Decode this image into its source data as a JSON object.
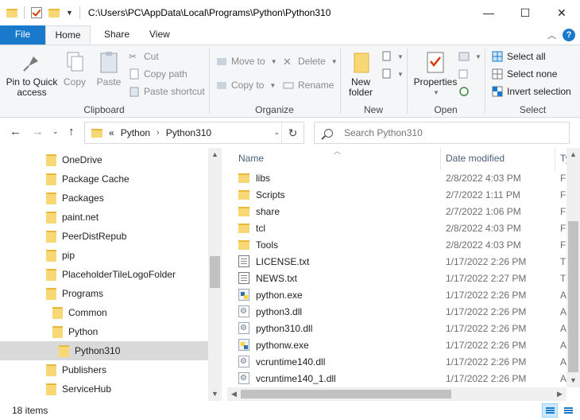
{
  "window": {
    "title_path": "C:\\Users\\PC\\AppData\\Local\\Programs\\Python\\Python310",
    "controls": {
      "minimize": "—",
      "maximize": "☐",
      "close": "✕"
    }
  },
  "ribbon_tabs": {
    "file": "File",
    "home": "Home",
    "share": "Share",
    "view": "View",
    "help": "?"
  },
  "ribbon": {
    "clipboard": {
      "label": "Clipboard",
      "pin_quick_access_line1": "Pin to Quick",
      "pin_quick_access_line2": "access",
      "copy": "Copy",
      "paste": "Paste",
      "cut": "Cut",
      "copy_path": "Copy path",
      "paste_shortcut": "Paste shortcut"
    },
    "organize": {
      "label": "Organize",
      "move_to": "Move to",
      "copy_to": "Copy to",
      "delete": "Delete",
      "rename": "Rename"
    },
    "new": {
      "label": "New",
      "new_folder_line1": "New",
      "new_folder_line2": "folder"
    },
    "open": {
      "label": "Open",
      "properties": "Properties"
    },
    "select": {
      "label": "Select",
      "select_all": "Select all",
      "select_none": "Select none",
      "invert_selection": "Invert selection"
    }
  },
  "address": {
    "overflow": "«",
    "crumbs": [
      "Python",
      "Python310"
    ],
    "search_placeholder": "Search Python310"
  },
  "nav_tree": [
    {
      "label": "OneDrive",
      "indent": 0,
      "selected": false
    },
    {
      "label": "Package Cache",
      "indent": 0,
      "selected": false
    },
    {
      "label": "Packages",
      "indent": 0,
      "selected": false
    },
    {
      "label": "paint.net",
      "indent": 0,
      "selected": false
    },
    {
      "label": "PeerDistRepub",
      "indent": 0,
      "selected": false
    },
    {
      "label": "pip",
      "indent": 0,
      "selected": false
    },
    {
      "label": "PlaceholderTileLogoFolder",
      "indent": 0,
      "selected": false
    },
    {
      "label": "Programs",
      "indent": 0,
      "selected": false
    },
    {
      "label": "Common",
      "indent": 1,
      "selected": false
    },
    {
      "label": "Python",
      "indent": 1,
      "selected": false
    },
    {
      "label": "Python310",
      "indent": 2,
      "selected": true
    },
    {
      "label": "Publishers",
      "indent": 0,
      "selected": false
    },
    {
      "label": "ServiceHub",
      "indent": 0,
      "selected": false
    }
  ],
  "columns": {
    "name": "Name",
    "date": "Date modified",
    "type": "Ty"
  },
  "files": [
    {
      "name": "libs",
      "date": "2/8/2022 4:03 PM",
      "type": "F",
      "icon": "folder"
    },
    {
      "name": "Scripts",
      "date": "2/7/2022 1:11 PM",
      "type": "F",
      "icon": "folder"
    },
    {
      "name": "share",
      "date": "2/7/2022 1:06 PM",
      "type": "F",
      "icon": "folder"
    },
    {
      "name": "tcl",
      "date": "2/8/2022 4:03 PM",
      "type": "F",
      "icon": "folder"
    },
    {
      "name": "Tools",
      "date": "2/8/2022 4:03 PM",
      "type": "F",
      "icon": "folder"
    },
    {
      "name": "LICENSE.txt",
      "date": "1/17/2022 2:26 PM",
      "type": "T",
      "icon": "txt"
    },
    {
      "name": "NEWS.txt",
      "date": "1/17/2022 2:27 PM",
      "type": "T",
      "icon": "txt"
    },
    {
      "name": "python.exe",
      "date": "1/17/2022 2:26 PM",
      "type": "A",
      "icon": "exe"
    },
    {
      "name": "python3.dll",
      "date": "1/17/2022 2:26 PM",
      "type": "A",
      "icon": "dll"
    },
    {
      "name": "python310.dll",
      "date": "1/17/2022 2:26 PM",
      "type": "A",
      "icon": "dll"
    },
    {
      "name": "pythonw.exe",
      "date": "1/17/2022 2:26 PM",
      "type": "A",
      "icon": "exe py"
    },
    {
      "name": "vcruntime140.dll",
      "date": "1/17/2022 2:26 PM",
      "type": "A",
      "icon": "dll"
    },
    {
      "name": "vcruntime140_1.dll",
      "date": "1/17/2022 2:26 PM",
      "type": "A",
      "icon": "dll"
    }
  ],
  "status": {
    "item_count": "18 items"
  },
  "colors": {
    "accent": "#1979ca",
    "folder": "#f8d775",
    "selected_row": "#d9d9d9"
  }
}
